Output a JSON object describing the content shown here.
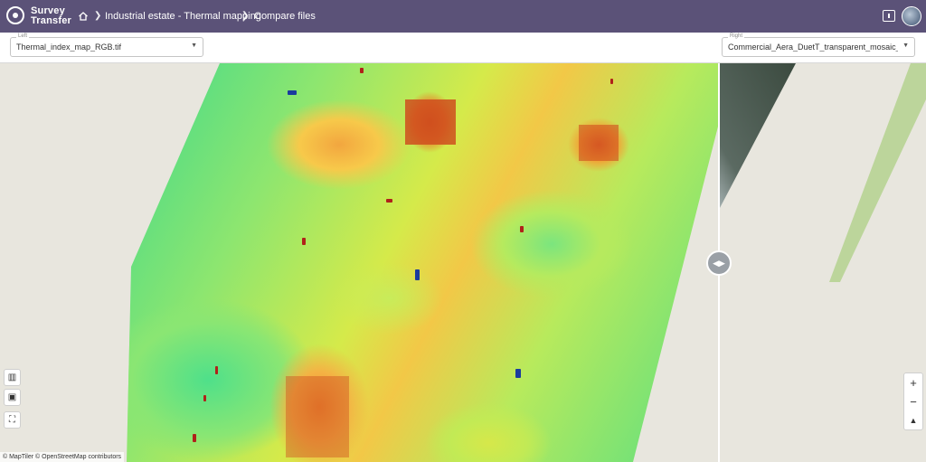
{
  "app": {
    "logo_line1": "Survey",
    "logo_line2": "Transfer"
  },
  "breadcrumb": {
    "item1": "Industrial estate - Thermal mapping",
    "item2": "Compare files"
  },
  "selectors": {
    "left": {
      "label": "Left",
      "value": "Thermal_index_map_RGB.tif"
    },
    "right": {
      "label": "Right",
      "value": "Commercial_Aera_DuetT_transparent_mosaic_RGB..."
    }
  },
  "map": {
    "attribution": "© MapTiler © OpenStreetMap contributors"
  },
  "icons": {
    "home": "home-icon",
    "chat": "feedback-icon",
    "map": "map-icon",
    "image": "image-icon",
    "fullscreen": "fullscreen-icon",
    "zoom_in": "+",
    "zoom_out": "−",
    "compass": "compass-icon"
  },
  "colors": {
    "topbar": "#5b5278",
    "hot": "#cf4f1e",
    "cool": "#3fd98c"
  }
}
